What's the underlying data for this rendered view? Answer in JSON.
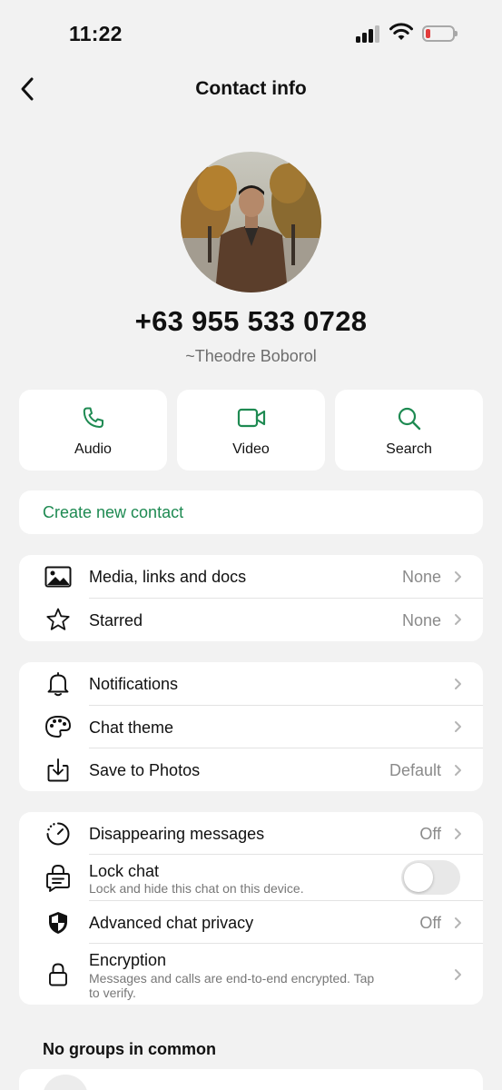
{
  "status_bar": {
    "time": "11:22"
  },
  "nav": {
    "title": "Contact info"
  },
  "profile": {
    "phone": "+63 955 533 0728",
    "push_name": "~Theodre Boborol"
  },
  "actions": [
    {
      "label": "Audio",
      "icon": "phone-icon"
    },
    {
      "label": "Video",
      "icon": "video-camera-icon"
    },
    {
      "label": "Search",
      "icon": "search-icon"
    }
  ],
  "create_contact": {
    "label": "Create new contact"
  },
  "group1": [
    {
      "label": "Media, links and docs",
      "value": "None",
      "icon": "image-icon"
    },
    {
      "label": "Starred",
      "value": "None",
      "icon": "star-icon"
    }
  ],
  "group2": [
    {
      "label": "Notifications",
      "value": "",
      "icon": "bell-icon"
    },
    {
      "label": "Chat theme",
      "value": "",
      "icon": "palette-icon"
    },
    {
      "label": "Save to Photos",
      "value": "Default",
      "icon": "save-download-icon"
    }
  ],
  "group3": {
    "disappearing": {
      "label": "Disappearing messages",
      "value": "Off",
      "icon": "timer-icon"
    },
    "lock_chat": {
      "label": "Lock chat",
      "subtitle": "Lock and hide this chat on this device.",
      "enabled": false,
      "icon": "lock-chat-icon"
    },
    "advanced_privacy": {
      "label": "Advanced chat privacy",
      "value": "Off",
      "icon": "shield-icon"
    },
    "encryption": {
      "label": "Encryption",
      "subtitle_line1": "Messages and calls are end-to-end encrypted. Tap",
      "subtitle_line2": "to verify.",
      "icon": "lock-icon"
    }
  },
  "groups_section": {
    "header": "No groups in common"
  },
  "colors": {
    "accent_green": "#1e8a52",
    "background": "#f2f2f2",
    "card": "#ffffff",
    "battery_low": "#e23b3b"
  }
}
